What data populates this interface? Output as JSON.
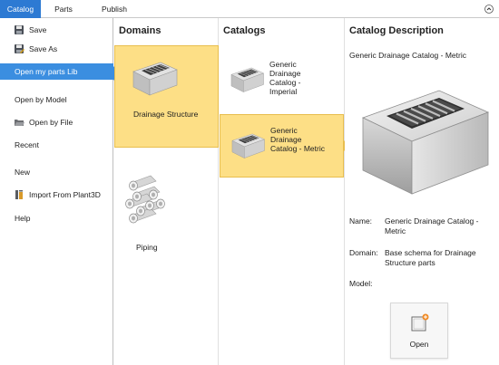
{
  "ribbon": {
    "tabs": [
      {
        "label": "Catalog",
        "active": true
      },
      {
        "label": "Parts",
        "active": false
      },
      {
        "label": "Publish",
        "active": false
      }
    ],
    "collapse_icon": "chevron-up-icon"
  },
  "menu": {
    "save": "Save",
    "save_as": "Save As",
    "open_my_parts_lib": "Open my parts Lib",
    "open_by_model": "Open by Model",
    "open_by_file": "Open by File",
    "recent": "Recent",
    "new": "New",
    "import_from_plant3d": "Import From Plant3D",
    "help": "Help"
  },
  "domains": {
    "header": "Domains",
    "items": [
      {
        "label": "Drainage Structure",
        "selected": true,
        "icon": "drainage-structure-icon"
      },
      {
        "label": "Piping",
        "selected": false,
        "icon": "piping-icon"
      }
    ]
  },
  "catalogs": {
    "header": "Catalogs",
    "items": [
      {
        "label": "Generic Drainage Catalog - Imperial",
        "selected": false
      },
      {
        "label": "Generic Drainage Catalog - Metric",
        "selected": true
      }
    ]
  },
  "description": {
    "header": "Catalog Description",
    "title": "Generic Drainage Catalog - Metric",
    "name_label": "Name:",
    "name_value": "Generic Drainage Catalog - Metric",
    "domain_label": "Domain:",
    "domain_value": "Base schema for Drainage Structure parts",
    "model_label": "Model:",
    "open_label": "Open"
  },
  "colors": {
    "accent": "#2d7ad3",
    "menu_selected": "#3b8ee0",
    "tile_selected": "#fddf86"
  }
}
